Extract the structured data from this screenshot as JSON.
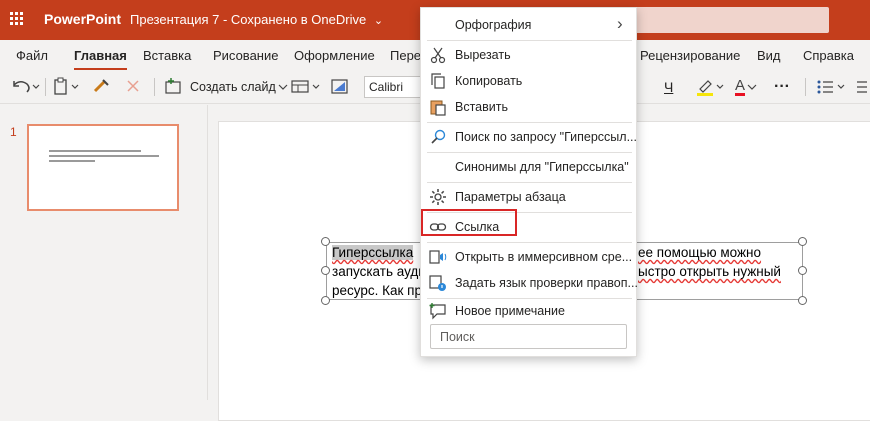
{
  "titlebar": {
    "app_name": "PowerPoint",
    "doc_title": "Презентация 7 - Сохранено в OneDrive",
    "doc_chevron": "⌄"
  },
  "tabs": [
    "Файл",
    "Главная",
    "Вставка",
    "Рисование",
    "Оформление",
    "Перех",
    "Рецензирование",
    "Вид",
    "Справка"
  ],
  "toolbar": {
    "new_slide_label": "Создать слайд",
    "font_name": "Calibri",
    "underline_glyph": "Ч",
    "font_color_glyph": "A",
    "more_glyph": "···"
  },
  "slide_panel": {
    "slide_number": "1"
  },
  "slide_text": {
    "line1_highlight": "Гиперссылка",
    "line1_tail": "ее помощью можно",
    "line2_head": "запускать ауди",
    "line2_tail": "ыстро открыть нужный",
    "line3_head": "ресурс.  Как пр"
  },
  "context_menu": {
    "items": [
      {
        "label": "Орфография",
        "icon": "none",
        "submenu_glyph": "›"
      },
      {
        "label": "Вырезать",
        "icon": "scissors-icon"
      },
      {
        "label": "Копировать",
        "icon": "copy-icon"
      },
      {
        "label": "Вставить",
        "icon": "paste-icon"
      },
      {
        "label": "Поиск по запросу \"Гиперссыл...",
        "icon": "search-icon"
      },
      {
        "label": "Синонимы для \"Гиперссылка\"",
        "icon": "none"
      },
      {
        "label": "Параметры абзаца",
        "icon": "gear-icon"
      },
      {
        "label": "Ссылка",
        "icon": "link-icon"
      },
      {
        "label": "Открыть в иммерсивном сре...",
        "icon": "immersive-reader-icon"
      },
      {
        "label": "Задать язык проверки правоп...",
        "icon": "language-icon"
      },
      {
        "label": "Новое примечание",
        "icon": "comment-icon"
      }
    ],
    "search_placeholder": "Поиск"
  },
  "colors": {
    "brand": "#c43e1c",
    "highlight_box": "#d92626",
    "spell_underline": "#e53935"
  }
}
